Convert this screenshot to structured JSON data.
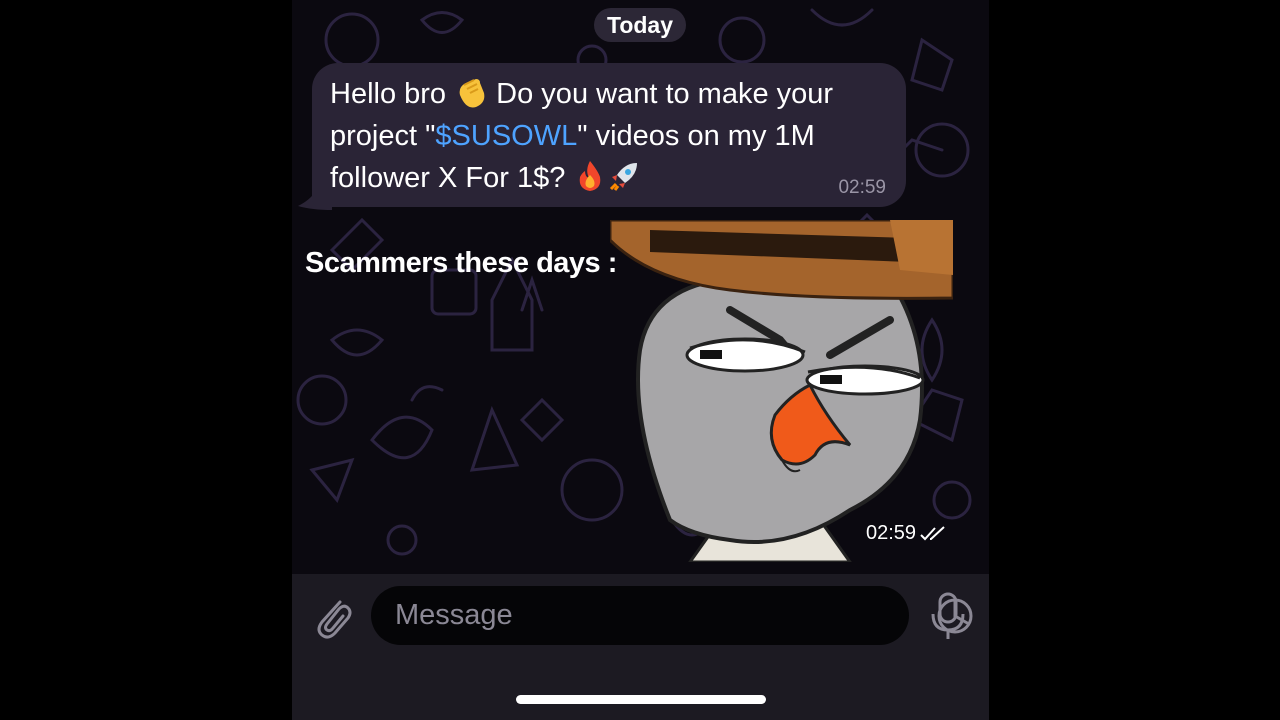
{
  "chat": {
    "date_separator": "Today",
    "incoming_message": {
      "text_part1": "Hello bro ",
      "emoji_wave": "waving-hand",
      "text_part2": " Do you want to make your project \"",
      "link_text": "$SUSOWL",
      "text_part3": "\" videos on my 1M follower X For 1$? ",
      "emoji_fire": "fire",
      "emoji_rocket": "rocket",
      "time": "02:59"
    },
    "sticker_message": {
      "caption": "Scammers these days :",
      "sticker_name": "owl-with-fedora-sticker",
      "time": "02:59",
      "status_icon": "double-check-icon"
    }
  },
  "composer": {
    "placeholder": "Message",
    "attach_icon": "paperclip-icon",
    "sticker_icon": "sticker-icon",
    "mic_icon": "microphone-icon"
  },
  "colors": {
    "background": "#0b0910",
    "bubble": "#2a2436",
    "link": "#4ea3ff",
    "composer": "#1c1a22"
  }
}
